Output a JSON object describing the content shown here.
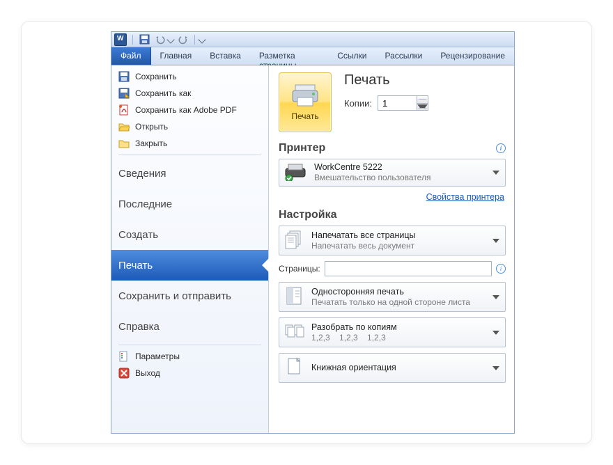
{
  "ribbon": {
    "file": "Файл",
    "tabs": [
      "Главная",
      "Вставка",
      "Разметка страницы",
      "Ссылки",
      "Рассылки",
      "Рецензирование"
    ]
  },
  "sidebar": {
    "save": "Сохранить",
    "saveAs": "Сохранить как",
    "savePdf": "Сохранить как Adobe PDF",
    "open": "Открыть",
    "close": "Закрыть",
    "info": "Сведения",
    "recent": "Последние",
    "new": "Создать",
    "print": "Печать",
    "share": "Сохранить и отправить",
    "help": "Справка",
    "options": "Параметры",
    "exit": "Выход"
  },
  "print": {
    "title": "Печать",
    "button": "Печать",
    "copiesLabel": "Копии:",
    "copiesValue": "1",
    "printerHead": "Принтер",
    "printerName": "WorkCentre 5222",
    "printerStatus": "Вмешательство пользователя",
    "printerProps": "Свойства принтера",
    "settingsHead": "Настройка",
    "opt1t": "Напечатать все страницы",
    "opt1s": "Напечатать весь документ",
    "pagesLabel": "Страницы:",
    "opt2t": "Односторонняя печать",
    "opt2s": "Печатать только на одной стороне листа",
    "opt3t": "Разобрать по копиям",
    "opt3s": "1,2,3    1,2,3    1,2,3",
    "opt4t": "Книжная ориентация"
  }
}
